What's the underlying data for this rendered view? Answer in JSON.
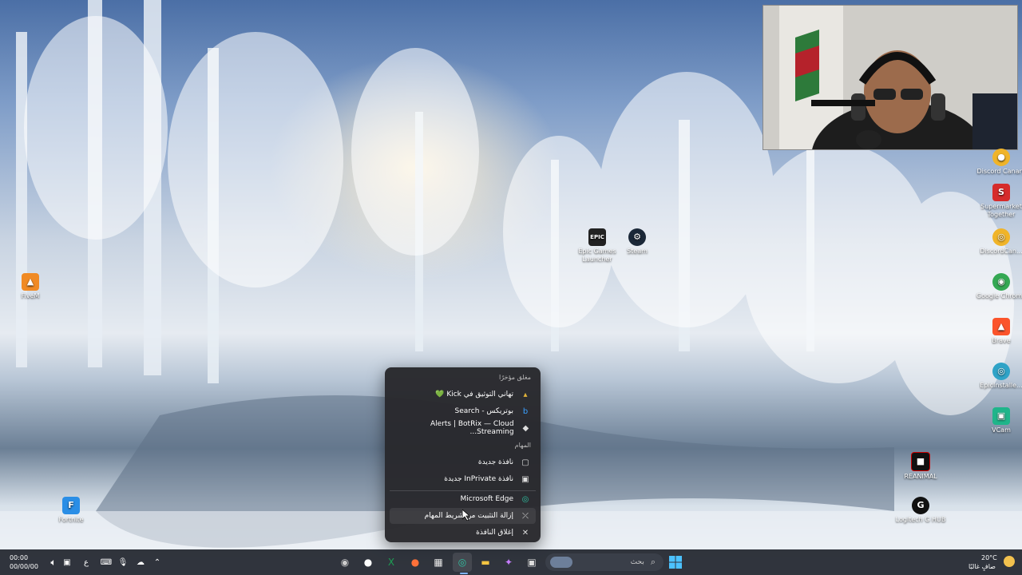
{
  "desktop": {
    "icons_left": [
      {
        "label": "FiveM",
        "glyph": "▲",
        "color": "#f08a24"
      },
      {
        "label": "Fortnite",
        "glyph": "F",
        "color": "#2a8ee6"
      }
    ],
    "icons_center": [
      {
        "label": "Epic Games Launcher",
        "glyph": "EPIC",
        "color": "#222"
      },
      {
        "label": "Steam",
        "glyph": "⚙",
        "color": "#1b2838"
      }
    ],
    "icons_right": [
      {
        "label": "Discord Canary",
        "glyph": "●",
        "color": "#f0b429"
      },
      {
        "label": "Supermarket Together",
        "glyph": "S",
        "color": "#d62b2b"
      },
      {
        "label": "DiscordCan...",
        "glyph": "◎",
        "color": "#f0b429"
      },
      {
        "label": "Google Chrome",
        "glyph": "◉",
        "color": "#34a853"
      },
      {
        "label": "Brave",
        "glyph": "▲",
        "color": "#fb542b"
      },
      {
        "label": "EpicInstalle...",
        "glyph": "◎",
        "color": "#2fa3c7"
      },
      {
        "label": "VCam",
        "glyph": "▣",
        "color": "#1fb58a"
      },
      {
        "label": "REANIMAL",
        "glyph": "■",
        "color": "#111"
      },
      {
        "label": "Logitech G HUB",
        "glyph": "G",
        "color": "#111"
      }
    ]
  },
  "jumplist": {
    "recent_header": "مغلق مؤخرًا",
    "recent": [
      {
        "label": "تهاني التوثيق في Kick 💚",
        "icon": "kick-icon",
        "glyph": "▴"
      },
      {
        "label": "بوتريكس - Search",
        "icon": "bing-icon",
        "glyph": "b"
      },
      {
        "label": "Alerts | BotRix — Cloud Streaming...",
        "icon": "botrix-icon",
        "glyph": "◆"
      }
    ],
    "tasks_header": "المهام",
    "tasks": [
      {
        "label": "نافذة جديدة",
        "icon": "new-window-icon",
        "glyph": "▢"
      },
      {
        "label": "نافذة InPrivate جديدة",
        "icon": "inprivate-icon",
        "glyph": "▣"
      }
    ],
    "app_name": "Microsoft Edge",
    "unpin": "إزالة التثبيت من شريط المهام",
    "close": "إغلاق النافذة"
  },
  "taskbar": {
    "search_placeholder": "بحث",
    "apps": [
      {
        "name": "obs-icon",
        "glyph": "◉"
      },
      {
        "name": "kick-app-icon",
        "glyph": "●"
      },
      {
        "name": "excel-icon",
        "glyph": "X"
      },
      {
        "name": "firefox-icon",
        "glyph": "●"
      },
      {
        "name": "store-icon",
        "glyph": "▦"
      },
      {
        "name": "edge-icon",
        "glyph": "◎"
      },
      {
        "name": "explorer-icon",
        "glyph": "▬"
      },
      {
        "name": "copilot-icon",
        "glyph": "✦"
      },
      {
        "name": "task-view-icon",
        "glyph": "▣"
      }
    ],
    "weather_temp": "20°C",
    "weather_desc": "صافٍ غالبًا",
    "clock_time": "00:00",
    "clock_date": "00/00/00",
    "lang": "ع"
  }
}
